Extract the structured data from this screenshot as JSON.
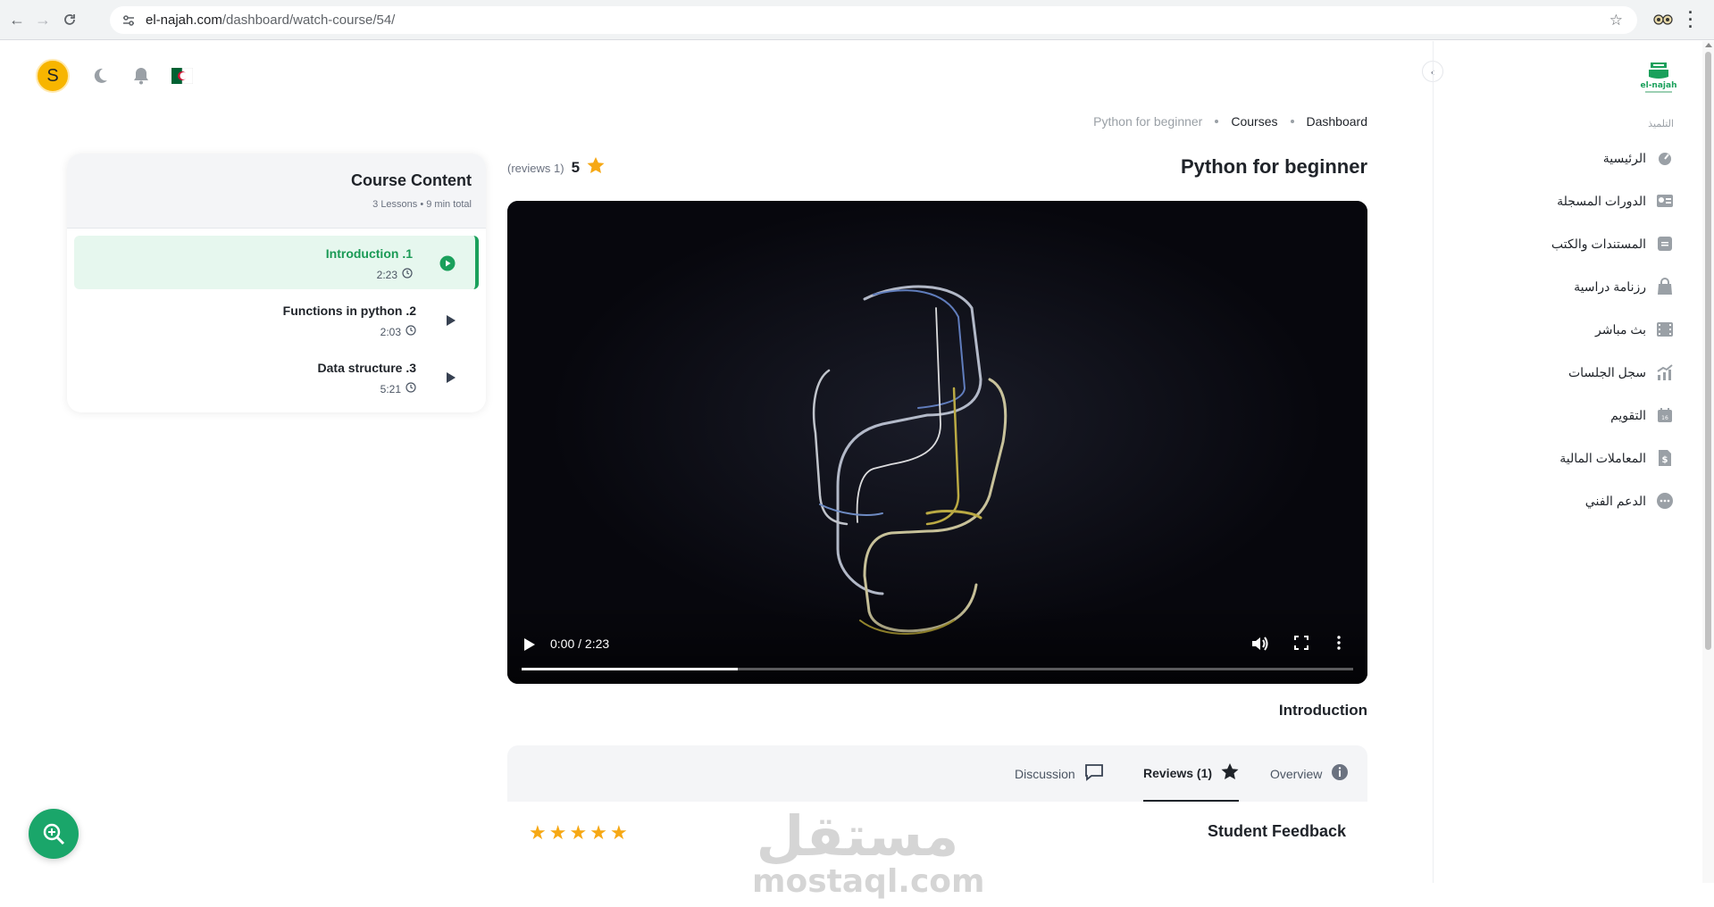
{
  "browser": {
    "url_domain": "el-najah.com",
    "url_path": "/dashboard/watch-course/54/"
  },
  "header": {
    "avatar_letter": "S"
  },
  "sidebar": {
    "brand": "el-najah",
    "section_label": "التلميذ",
    "items": [
      {
        "label": "الرئيسية",
        "icon": "speedometer-icon"
      },
      {
        "label": "الدورات المسجلة",
        "icon": "certificate-icon"
      },
      {
        "label": "المستندات والكتب",
        "icon": "document-icon"
      },
      {
        "label": "رزنامة دراسية",
        "icon": "bag-icon"
      },
      {
        "label": "بث مباشر",
        "icon": "film-icon"
      },
      {
        "label": "سجل الجلسات",
        "icon": "chart-icon"
      },
      {
        "label": "التقويم",
        "icon": "calendar-icon"
      },
      {
        "label": "المعاملات المالية",
        "icon": "dollar-icon"
      },
      {
        "label": "الدعم الفني",
        "icon": "chat-icon"
      }
    ]
  },
  "breadcrumb": {
    "items": [
      "Dashboard",
      "Courses",
      "Python for beginner"
    ]
  },
  "course": {
    "title": "Python for beginner",
    "rating_value": "5",
    "reviews_count": "(reviews 1)"
  },
  "video": {
    "time": "0:00 / 2:23",
    "buffered_fraction": 0.26
  },
  "current_lesson_title": "Introduction",
  "tabs": [
    {
      "label": "Overview",
      "icon": "info-icon"
    },
    {
      "label": "Reviews (1)",
      "icon": "star-icon",
      "active": true
    },
    {
      "label": "Discussion",
      "icon": "comment-icon"
    }
  ],
  "feedback": {
    "title": "Student Feedback",
    "stars": 5
  },
  "course_content": {
    "title": "Course Content",
    "summary": "3 Lessons • 9 min total",
    "lessons": [
      {
        "title": "Introduction .1",
        "duration": "2:23",
        "active": true
      },
      {
        "title": "Functions in python .2",
        "duration": "2:03",
        "active": false
      },
      {
        "title": "Data structure .3",
        "duration": "5:21",
        "active": false
      }
    ]
  },
  "watermark": {
    "arabic": "مستقل",
    "latin": "mostaql.com"
  },
  "colors": {
    "accent": "#1aa05b",
    "star": "#f6a814",
    "avatar": "#f7b500"
  }
}
